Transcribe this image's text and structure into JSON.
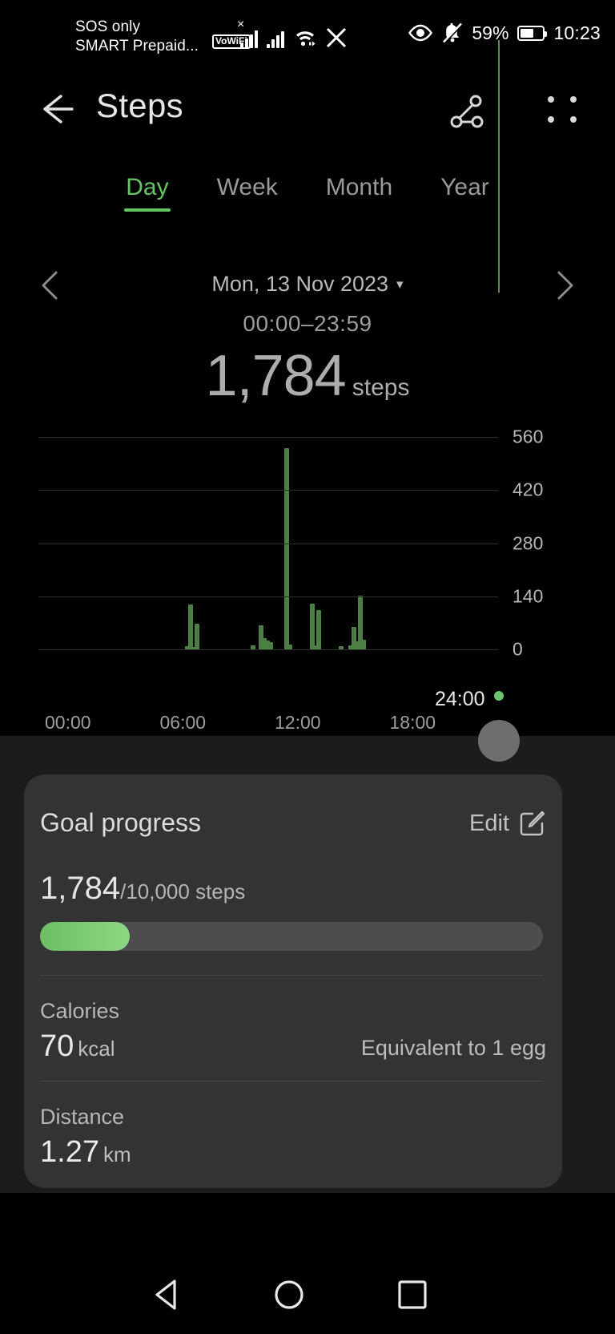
{
  "statusbar": {
    "carrier_line1": "SOS only",
    "carrier_line2": "SMART Prepaid...",
    "vowifi_badge": "VoWiFi",
    "battery_percent": "59%",
    "time": "10:23",
    "icons": [
      "signal-no-service-icon",
      "signal-bars-icon",
      "wifi-icon",
      "x-app-icon",
      "eye-comfort-icon",
      "bell-off-icon",
      "battery-icon"
    ]
  },
  "appbar": {
    "title": "Steps",
    "back_icon": "back-arrow-icon",
    "share_icon": "share-icon",
    "menu_icon": "grid-menu-icon"
  },
  "tabs": [
    {
      "label": "Day",
      "active": true
    },
    {
      "label": "Week",
      "active": false
    },
    {
      "label": "Month",
      "active": false
    },
    {
      "label": "Year",
      "active": false
    }
  ],
  "datenav": {
    "prev_icon": "chevron-left-icon",
    "next_icon": "chevron-right-icon",
    "date": "Mon, 13 Nov 2023",
    "caret": "▾",
    "time_range": "00:00–23:59",
    "total_value": "1,784",
    "total_unit": "steps"
  },
  "chart_data": {
    "type": "bar",
    "title": "Steps per time interval",
    "xlabel": "",
    "ylabel": "steps",
    "ylim": [
      0,
      560
    ],
    "yticks": [
      0,
      140,
      280,
      420,
      560
    ],
    "ytick_labels": [
      "0",
      "140",
      "280",
      "420",
      "560"
    ],
    "xticks": [
      "00:00",
      "06:00",
      "12:00",
      "18:00"
    ],
    "xtick_positions_pct": [
      0,
      25,
      50,
      75
    ],
    "grid": true,
    "marker_label": "24:00",
    "bar_color": "#4c7f43",
    "x": [
      "07:40",
      "07:50",
      "08:00",
      "08:10",
      "11:05",
      "11:30",
      "11:40",
      "11:50",
      "12:00",
      "12:50",
      "13:00",
      "14:10",
      "14:20",
      "14:30",
      "15:40",
      "16:10",
      "16:20",
      "16:30",
      "16:40",
      "16:50"
    ],
    "values": [
      8,
      118,
      6,
      68,
      10,
      64,
      30,
      24,
      18,
      530,
      12,
      120,
      10,
      104,
      8,
      10,
      60,
      22,
      142,
      26
    ]
  },
  "sheet": {
    "goal_title": "Goal progress",
    "edit_label": "Edit",
    "edit_icon": "edit-pencil-icon",
    "current_steps": "1,784",
    "goal_steps": "/10,000 steps",
    "progress_percent": 17.8,
    "calories": {
      "label": "Calories",
      "value": "70",
      "unit": "kcal",
      "note": "Equivalent to 1 egg"
    },
    "distance": {
      "label": "Distance",
      "value": "1.27",
      "unit": "km"
    }
  },
  "navbar": {
    "back_icon": "nav-back-triangle-icon",
    "home_icon": "nav-home-circle-icon",
    "recent_icon": "nav-recent-square-icon"
  },
  "colors": {
    "accent_green": "#64c466",
    "bar_green": "#4c7f43",
    "progress_green": "#6bbf63",
    "background": "#000000",
    "card": "#333333"
  }
}
